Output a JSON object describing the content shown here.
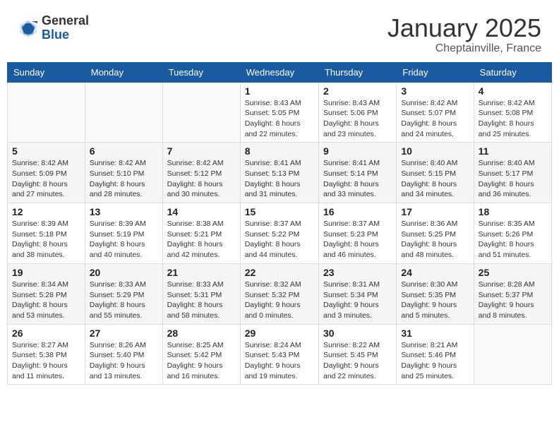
{
  "header": {
    "logo_general": "General",
    "logo_blue": "Blue",
    "month_title": "January 2025",
    "location": "Cheptainville, France"
  },
  "days_of_week": [
    "Sunday",
    "Monday",
    "Tuesday",
    "Wednesday",
    "Thursday",
    "Friday",
    "Saturday"
  ],
  "weeks": [
    {
      "days": [
        {
          "date": "",
          "info": ""
        },
        {
          "date": "",
          "info": ""
        },
        {
          "date": "",
          "info": ""
        },
        {
          "date": "1",
          "info": "Sunrise: 8:43 AM\nSunset: 5:05 PM\nDaylight: 8 hours\nand 22 minutes."
        },
        {
          "date": "2",
          "info": "Sunrise: 8:43 AM\nSunset: 5:06 PM\nDaylight: 8 hours\nand 23 minutes."
        },
        {
          "date": "3",
          "info": "Sunrise: 8:42 AM\nSunset: 5:07 PM\nDaylight: 8 hours\nand 24 minutes."
        },
        {
          "date": "4",
          "info": "Sunrise: 8:42 AM\nSunset: 5:08 PM\nDaylight: 8 hours\nand 25 minutes."
        }
      ]
    },
    {
      "days": [
        {
          "date": "5",
          "info": "Sunrise: 8:42 AM\nSunset: 5:09 PM\nDaylight: 8 hours\nand 27 minutes."
        },
        {
          "date": "6",
          "info": "Sunrise: 8:42 AM\nSunset: 5:10 PM\nDaylight: 8 hours\nand 28 minutes."
        },
        {
          "date": "7",
          "info": "Sunrise: 8:42 AM\nSunset: 5:12 PM\nDaylight: 8 hours\nand 30 minutes."
        },
        {
          "date": "8",
          "info": "Sunrise: 8:41 AM\nSunset: 5:13 PM\nDaylight: 8 hours\nand 31 minutes."
        },
        {
          "date": "9",
          "info": "Sunrise: 8:41 AM\nSunset: 5:14 PM\nDaylight: 8 hours\nand 33 minutes."
        },
        {
          "date": "10",
          "info": "Sunrise: 8:40 AM\nSunset: 5:15 PM\nDaylight: 8 hours\nand 34 minutes."
        },
        {
          "date": "11",
          "info": "Sunrise: 8:40 AM\nSunset: 5:17 PM\nDaylight: 8 hours\nand 36 minutes."
        }
      ]
    },
    {
      "days": [
        {
          "date": "12",
          "info": "Sunrise: 8:39 AM\nSunset: 5:18 PM\nDaylight: 8 hours\nand 38 minutes."
        },
        {
          "date": "13",
          "info": "Sunrise: 8:39 AM\nSunset: 5:19 PM\nDaylight: 8 hours\nand 40 minutes."
        },
        {
          "date": "14",
          "info": "Sunrise: 8:38 AM\nSunset: 5:21 PM\nDaylight: 8 hours\nand 42 minutes."
        },
        {
          "date": "15",
          "info": "Sunrise: 8:37 AM\nSunset: 5:22 PM\nDaylight: 8 hours\nand 44 minutes."
        },
        {
          "date": "16",
          "info": "Sunrise: 8:37 AM\nSunset: 5:23 PM\nDaylight: 8 hours\nand 46 minutes."
        },
        {
          "date": "17",
          "info": "Sunrise: 8:36 AM\nSunset: 5:25 PM\nDaylight: 8 hours\nand 48 minutes."
        },
        {
          "date": "18",
          "info": "Sunrise: 8:35 AM\nSunset: 5:26 PM\nDaylight: 8 hours\nand 51 minutes."
        }
      ]
    },
    {
      "days": [
        {
          "date": "19",
          "info": "Sunrise: 8:34 AM\nSunset: 5:28 PM\nDaylight: 8 hours\nand 53 minutes."
        },
        {
          "date": "20",
          "info": "Sunrise: 8:33 AM\nSunset: 5:29 PM\nDaylight: 8 hours\nand 55 minutes."
        },
        {
          "date": "21",
          "info": "Sunrise: 8:33 AM\nSunset: 5:31 PM\nDaylight: 8 hours\nand 58 minutes."
        },
        {
          "date": "22",
          "info": "Sunrise: 8:32 AM\nSunset: 5:32 PM\nDaylight: 9 hours\nand 0 minutes."
        },
        {
          "date": "23",
          "info": "Sunrise: 8:31 AM\nSunset: 5:34 PM\nDaylight: 9 hours\nand 3 minutes."
        },
        {
          "date": "24",
          "info": "Sunrise: 8:30 AM\nSunset: 5:35 PM\nDaylight: 9 hours\nand 5 minutes."
        },
        {
          "date": "25",
          "info": "Sunrise: 8:28 AM\nSunset: 5:37 PM\nDaylight: 9 hours\nand 8 minutes."
        }
      ]
    },
    {
      "days": [
        {
          "date": "26",
          "info": "Sunrise: 8:27 AM\nSunset: 5:38 PM\nDaylight: 9 hours\nand 11 minutes."
        },
        {
          "date": "27",
          "info": "Sunrise: 8:26 AM\nSunset: 5:40 PM\nDaylight: 9 hours\nand 13 minutes."
        },
        {
          "date": "28",
          "info": "Sunrise: 8:25 AM\nSunset: 5:42 PM\nDaylight: 9 hours\nand 16 minutes."
        },
        {
          "date": "29",
          "info": "Sunrise: 8:24 AM\nSunset: 5:43 PM\nDaylight: 9 hours\nand 19 minutes."
        },
        {
          "date": "30",
          "info": "Sunrise: 8:22 AM\nSunset: 5:45 PM\nDaylight: 9 hours\nand 22 minutes."
        },
        {
          "date": "31",
          "info": "Sunrise: 8:21 AM\nSunset: 5:46 PM\nDaylight: 9 hours\nand 25 minutes."
        },
        {
          "date": "",
          "info": ""
        }
      ]
    }
  ]
}
